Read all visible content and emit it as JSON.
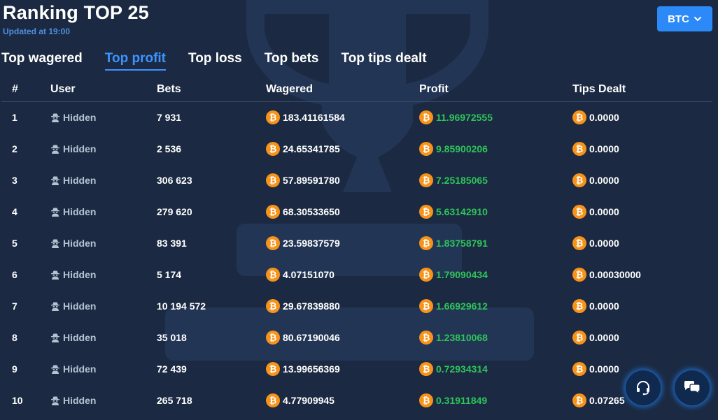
{
  "header": {
    "title": "Ranking TOP 25",
    "updated": "Updated at 19:00"
  },
  "currency": {
    "label": "BTC",
    "icon": "chevron-down-icon"
  },
  "tabs": [
    {
      "label": "Top wagered",
      "active": false
    },
    {
      "label": "Top profit",
      "active": true
    },
    {
      "label": "Top loss",
      "active": false
    },
    {
      "label": "Top bets",
      "active": false
    },
    {
      "label": "Top tips dealt",
      "active": false
    }
  ],
  "table": {
    "columns": [
      "#",
      "User",
      "Bets",
      "Wagered",
      "Profit",
      "Tips Dealt"
    ],
    "rows": [
      {
        "rank": "1",
        "user": "Hidden",
        "bets": "7 931",
        "wagered": "183.41161584",
        "profit": "11.96972555",
        "tips": "0.0000"
      },
      {
        "rank": "2",
        "user": "Hidden",
        "bets": "2 536",
        "wagered": "24.65341785",
        "profit": "9.85900206",
        "tips": "0.0000"
      },
      {
        "rank": "3",
        "user": "Hidden",
        "bets": "306 623",
        "wagered": "57.89591780",
        "profit": "7.25185065",
        "tips": "0.0000"
      },
      {
        "rank": "4",
        "user": "Hidden",
        "bets": "279 620",
        "wagered": "68.30533650",
        "profit": "5.63142910",
        "tips": "0.0000"
      },
      {
        "rank": "5",
        "user": "Hidden",
        "bets": "83 391",
        "wagered": "23.59837579",
        "profit": "1.83758791",
        "tips": "0.0000"
      },
      {
        "rank": "6",
        "user": "Hidden",
        "bets": "5 174",
        "wagered": "4.07151070",
        "profit": "1.79090434",
        "tips": "0.00030000"
      },
      {
        "rank": "7",
        "user": "Hidden",
        "bets": "10 194 572",
        "wagered": "29.67839880",
        "profit": "1.66929612",
        "tips": "0.0000"
      },
      {
        "rank": "8",
        "user": "Hidden",
        "bets": "35 018",
        "wagered": "80.67190046",
        "profit": "1.23810068",
        "tips": "0.0000"
      },
      {
        "rank": "9",
        "user": "Hidden",
        "bets": "72 439",
        "wagered": "13.99656369",
        "profit": "0.72934314",
        "tips": "0.0000"
      },
      {
        "rank": "10",
        "user": "Hidden",
        "bets": "265 718",
        "wagered": "4.77909945",
        "profit": "0.31911849",
        "tips": "0.07265"
      }
    ]
  },
  "floating_buttons": [
    {
      "icon": "headset-icon"
    },
    {
      "icon": "chat-bubbles-icon"
    }
  ],
  "colors": {
    "background": "#1b2a42",
    "accent": "#2b8af7",
    "profit": "#2ec45a",
    "coin": "#f7931a"
  }
}
